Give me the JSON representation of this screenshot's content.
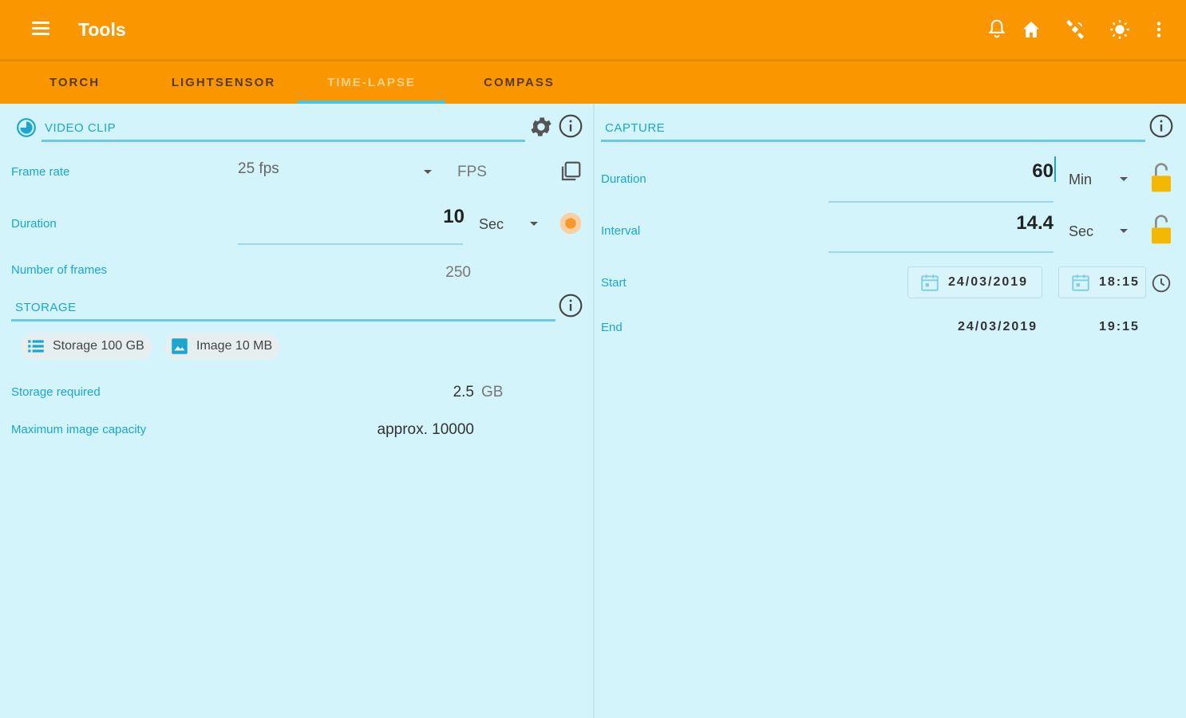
{
  "appbar": {
    "title": "Tools",
    "icons": [
      "menu-icon",
      "bell-icon",
      "home-icon",
      "satellite-icon",
      "brightness-icon",
      "more-vert-icon"
    ]
  },
  "tabs": [
    {
      "label": "TORCH"
    },
    {
      "label": "LIGHTSENSOR"
    },
    {
      "label": "TIME-LAPSE"
    },
    {
      "label": "COMPASS"
    }
  ],
  "active_tab": "TIME-LAPSE",
  "video_clip": {
    "title": "VIDEO CLIP",
    "frame_rate_label": "Frame rate",
    "frame_rate_value": "25 fps",
    "frame_rate_unit": "FPS",
    "duration_label": "Duration",
    "duration_value": "10",
    "duration_unit": "Sec",
    "frames_label": "Number of frames",
    "frames_value": "250"
  },
  "storage": {
    "title": "STORAGE",
    "chip_storage": "Storage 100 GB",
    "chip_image": "Image 10 MB",
    "required_label": "Storage required",
    "required_value": "2.5",
    "required_unit": "GB",
    "capacity_label": "Maximum image capacity",
    "capacity_value": "approx. 10000"
  },
  "capture": {
    "title": "CAPTURE",
    "duration_label": "Duration",
    "duration_value": "60",
    "duration_unit": "Min",
    "interval_label": "Interval",
    "interval_value": "14.4",
    "interval_unit": "Sec",
    "start_label": "Start",
    "start_date": "24/03/2019",
    "start_time": "18:15",
    "end_label": "End",
    "end_date": "24/03/2019",
    "end_time": "19:15"
  },
  "colors": {
    "appbar": "#fa9600",
    "accent": "#1aa6cf",
    "background": "#d4f4fb",
    "lock": "#f5b800"
  }
}
